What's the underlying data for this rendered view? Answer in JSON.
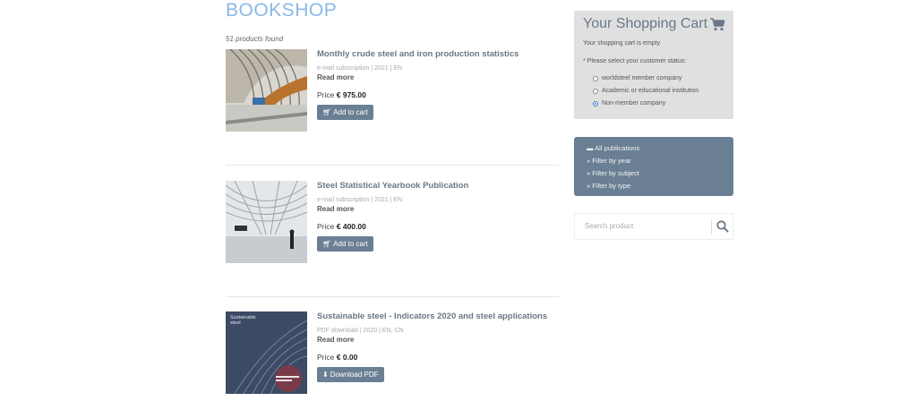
{
  "page": {
    "title": "BOOKSHOP",
    "count_text": "51 products found"
  },
  "products": [
    {
      "name": "Monthly crude steel and iron production statistics",
      "meta": "e-mail subscription | 2021 | EN",
      "read_more": "Read more",
      "price_label": "Price",
      "price": "€ 975.00",
      "action": "Add to cart",
      "action_icon": "cart-icon"
    },
    {
      "name": "Steel Statistical Yearbook Publication",
      "meta": "e-mail subscription | 2021 | EN",
      "read_more": "Read more",
      "price_label": "Price",
      "price": "€ 400.00",
      "action": "Add to cart",
      "action_icon": "cart-icon"
    },
    {
      "name": "Sustainable steel - Indicators 2020 and steel applications",
      "meta": "PDF download | 2020 | EN, CN",
      "read_more": "Read more",
      "price_label": "Price",
      "price": "€ 0.00",
      "action": "Download PDF",
      "action_icon": "download-icon",
      "cover_text": "Sustainable steel"
    }
  ],
  "cart": {
    "title": "Your Shopping Cart",
    "empty_text": "Your shopping cart is empty",
    "status_prompt": "* Please select your customer status:",
    "options": [
      {
        "label": "worldsteel member company",
        "checked": false
      },
      {
        "label": "Academic or educational institution",
        "checked": false
      },
      {
        "label": "Non-member company",
        "checked": true
      }
    ]
  },
  "filters": {
    "items": [
      {
        "label": "All publications",
        "icon": "folder-icon"
      },
      {
        "label": "Filter by year",
        "icon": "double-chevron-icon"
      },
      {
        "label": "Filter by subject",
        "icon": "double-chevron-icon"
      },
      {
        "label": "Filter by type",
        "icon": "double-chevron-icon"
      }
    ]
  },
  "search": {
    "placeholder": "Search product"
  },
  "colors": {
    "title": "#8ab8e6",
    "accent": "#6a7f93",
    "cart_bg": "#e0e0e0",
    "product_name": "#6a7787"
  }
}
